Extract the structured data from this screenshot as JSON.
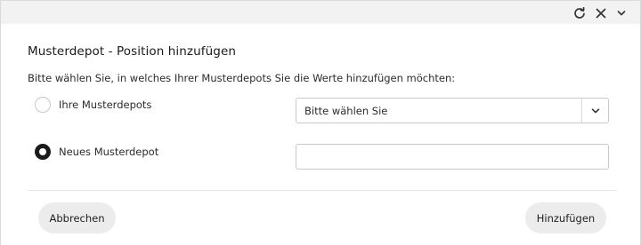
{
  "titlebar": {
    "icons": [
      "refresh-icon",
      "close-icon",
      "chevron-down-icon"
    ]
  },
  "dialog": {
    "title": "Musterdepot - Position hinzufügen",
    "instruction": "Bitte wählen Sie, in welches Ihrer Musterdepots Sie die Werte hinzufügen möchten:",
    "options": [
      {
        "label": "Ihre Musterdepots",
        "selected": false
      },
      {
        "label": "Neues Musterdepot",
        "selected": true
      }
    ],
    "select": {
      "value": "Bitte wählen Sie"
    },
    "new_depot_input": {
      "value": "",
      "placeholder": ""
    },
    "buttons": {
      "cancel": "Abbrechen",
      "add": "Hinzufügen"
    }
  }
}
